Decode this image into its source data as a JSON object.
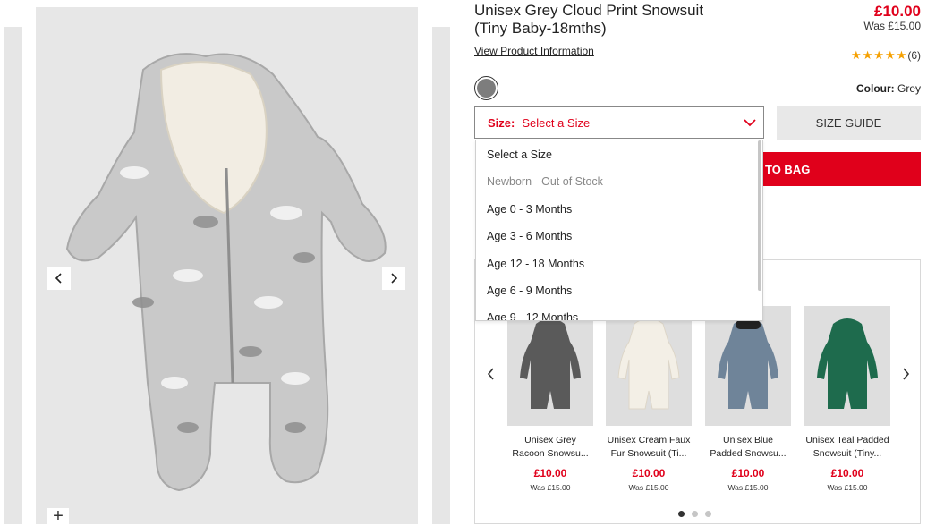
{
  "product": {
    "title_line1": "Unisex Grey Cloud Print Snowsuit",
    "title_line2": "(Tiny Baby-18mths)",
    "price": "£10.00",
    "was_price": "Was £15.00",
    "view_info": "View Product Information",
    "review_count": "(6)",
    "rating": 5,
    "colour_label": "Colour:",
    "colour_value": "Grey",
    "swatch_color": "#7d7d7d"
  },
  "size": {
    "label": "Size:",
    "value": "Select a Size",
    "guide": "SIZE GUIDE",
    "options": [
      {
        "label": "Select a Size",
        "disabled": false
      },
      {
        "label": "Newborn - Out of Stock",
        "disabled": true
      },
      {
        "label": "Age 0 - 3 Months",
        "disabled": false
      },
      {
        "label": "Age 3 - 6 Months",
        "disabled": false
      },
      {
        "label": "Age 12 - 18 Months",
        "disabled": false
      },
      {
        "label": "Age 6 - 9 Months",
        "disabled": false
      },
      {
        "label": "Age 9 - 12 Months",
        "disabled": false
      }
    ]
  },
  "add_to_bag": "TO BAG",
  "gallery": {
    "zoom": "+"
  },
  "recommendations": [
    {
      "name1": "Unisex Grey",
      "name2": "Racoon Snowsu...",
      "price": "£10.00",
      "was": "Was £15.00",
      "color": "#5a5a5a"
    },
    {
      "name1": "Unisex Cream Faux",
      "name2": "Fur Snowsuit (Ti...",
      "price": "£10.00",
      "was": "Was £15.00",
      "color": "#f3efe6"
    },
    {
      "name1": "Unisex Blue",
      "name2": "Padded Snowsu...",
      "price": "£10.00",
      "was": "Was £15.00",
      "color": "#6f8499"
    },
    {
      "name1": "Unisex Teal Padded",
      "name2": "Snowsuit (Tiny...",
      "price": "£10.00",
      "was": "Was £15.00",
      "color": "#1e6b4d"
    }
  ],
  "colors": {
    "accent": "#e0001b",
    "star": "#f5a000"
  }
}
